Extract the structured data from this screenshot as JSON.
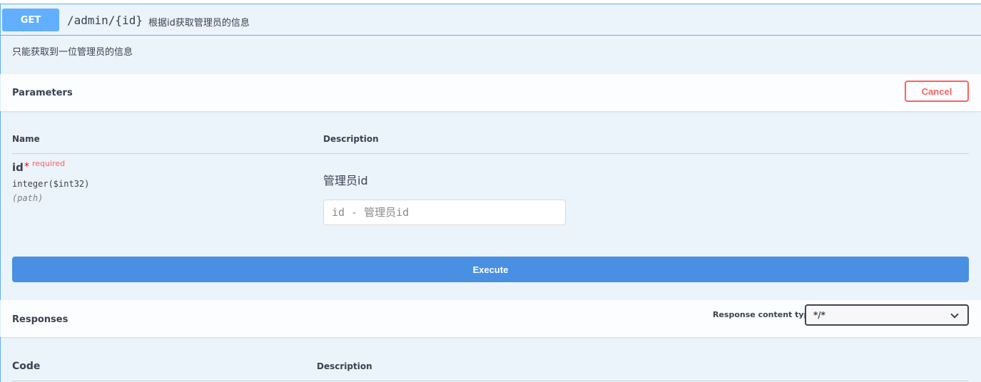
{
  "operation": {
    "method": "GET",
    "path": "/admin/{id}",
    "summary": "根据id获取管理员的信息",
    "description": "只能获取到一位管理员的信息"
  },
  "parameters": {
    "title": "Parameters",
    "cancel_label": "Cancel",
    "col_name": "Name",
    "col_description": "Description",
    "items": [
      {
        "name": "id",
        "required_star": "*",
        "required_label": "required",
        "type": "integer($int32)",
        "in": "(path)",
        "description": "管理员id",
        "placeholder": "id - 管理员id",
        "value": ""
      }
    ]
  },
  "execute_label": "Execute",
  "responses": {
    "title": "Responses",
    "content_type_label": "Response content type",
    "content_type_value": "*/*",
    "col_code": "Code",
    "col_description": "Description"
  },
  "colors": {
    "get_method": "#61affe",
    "opblock_bg": "#ebf3fb",
    "cancel": "#ff6060",
    "execute": "#4990e2",
    "required": "#ff6060"
  }
}
